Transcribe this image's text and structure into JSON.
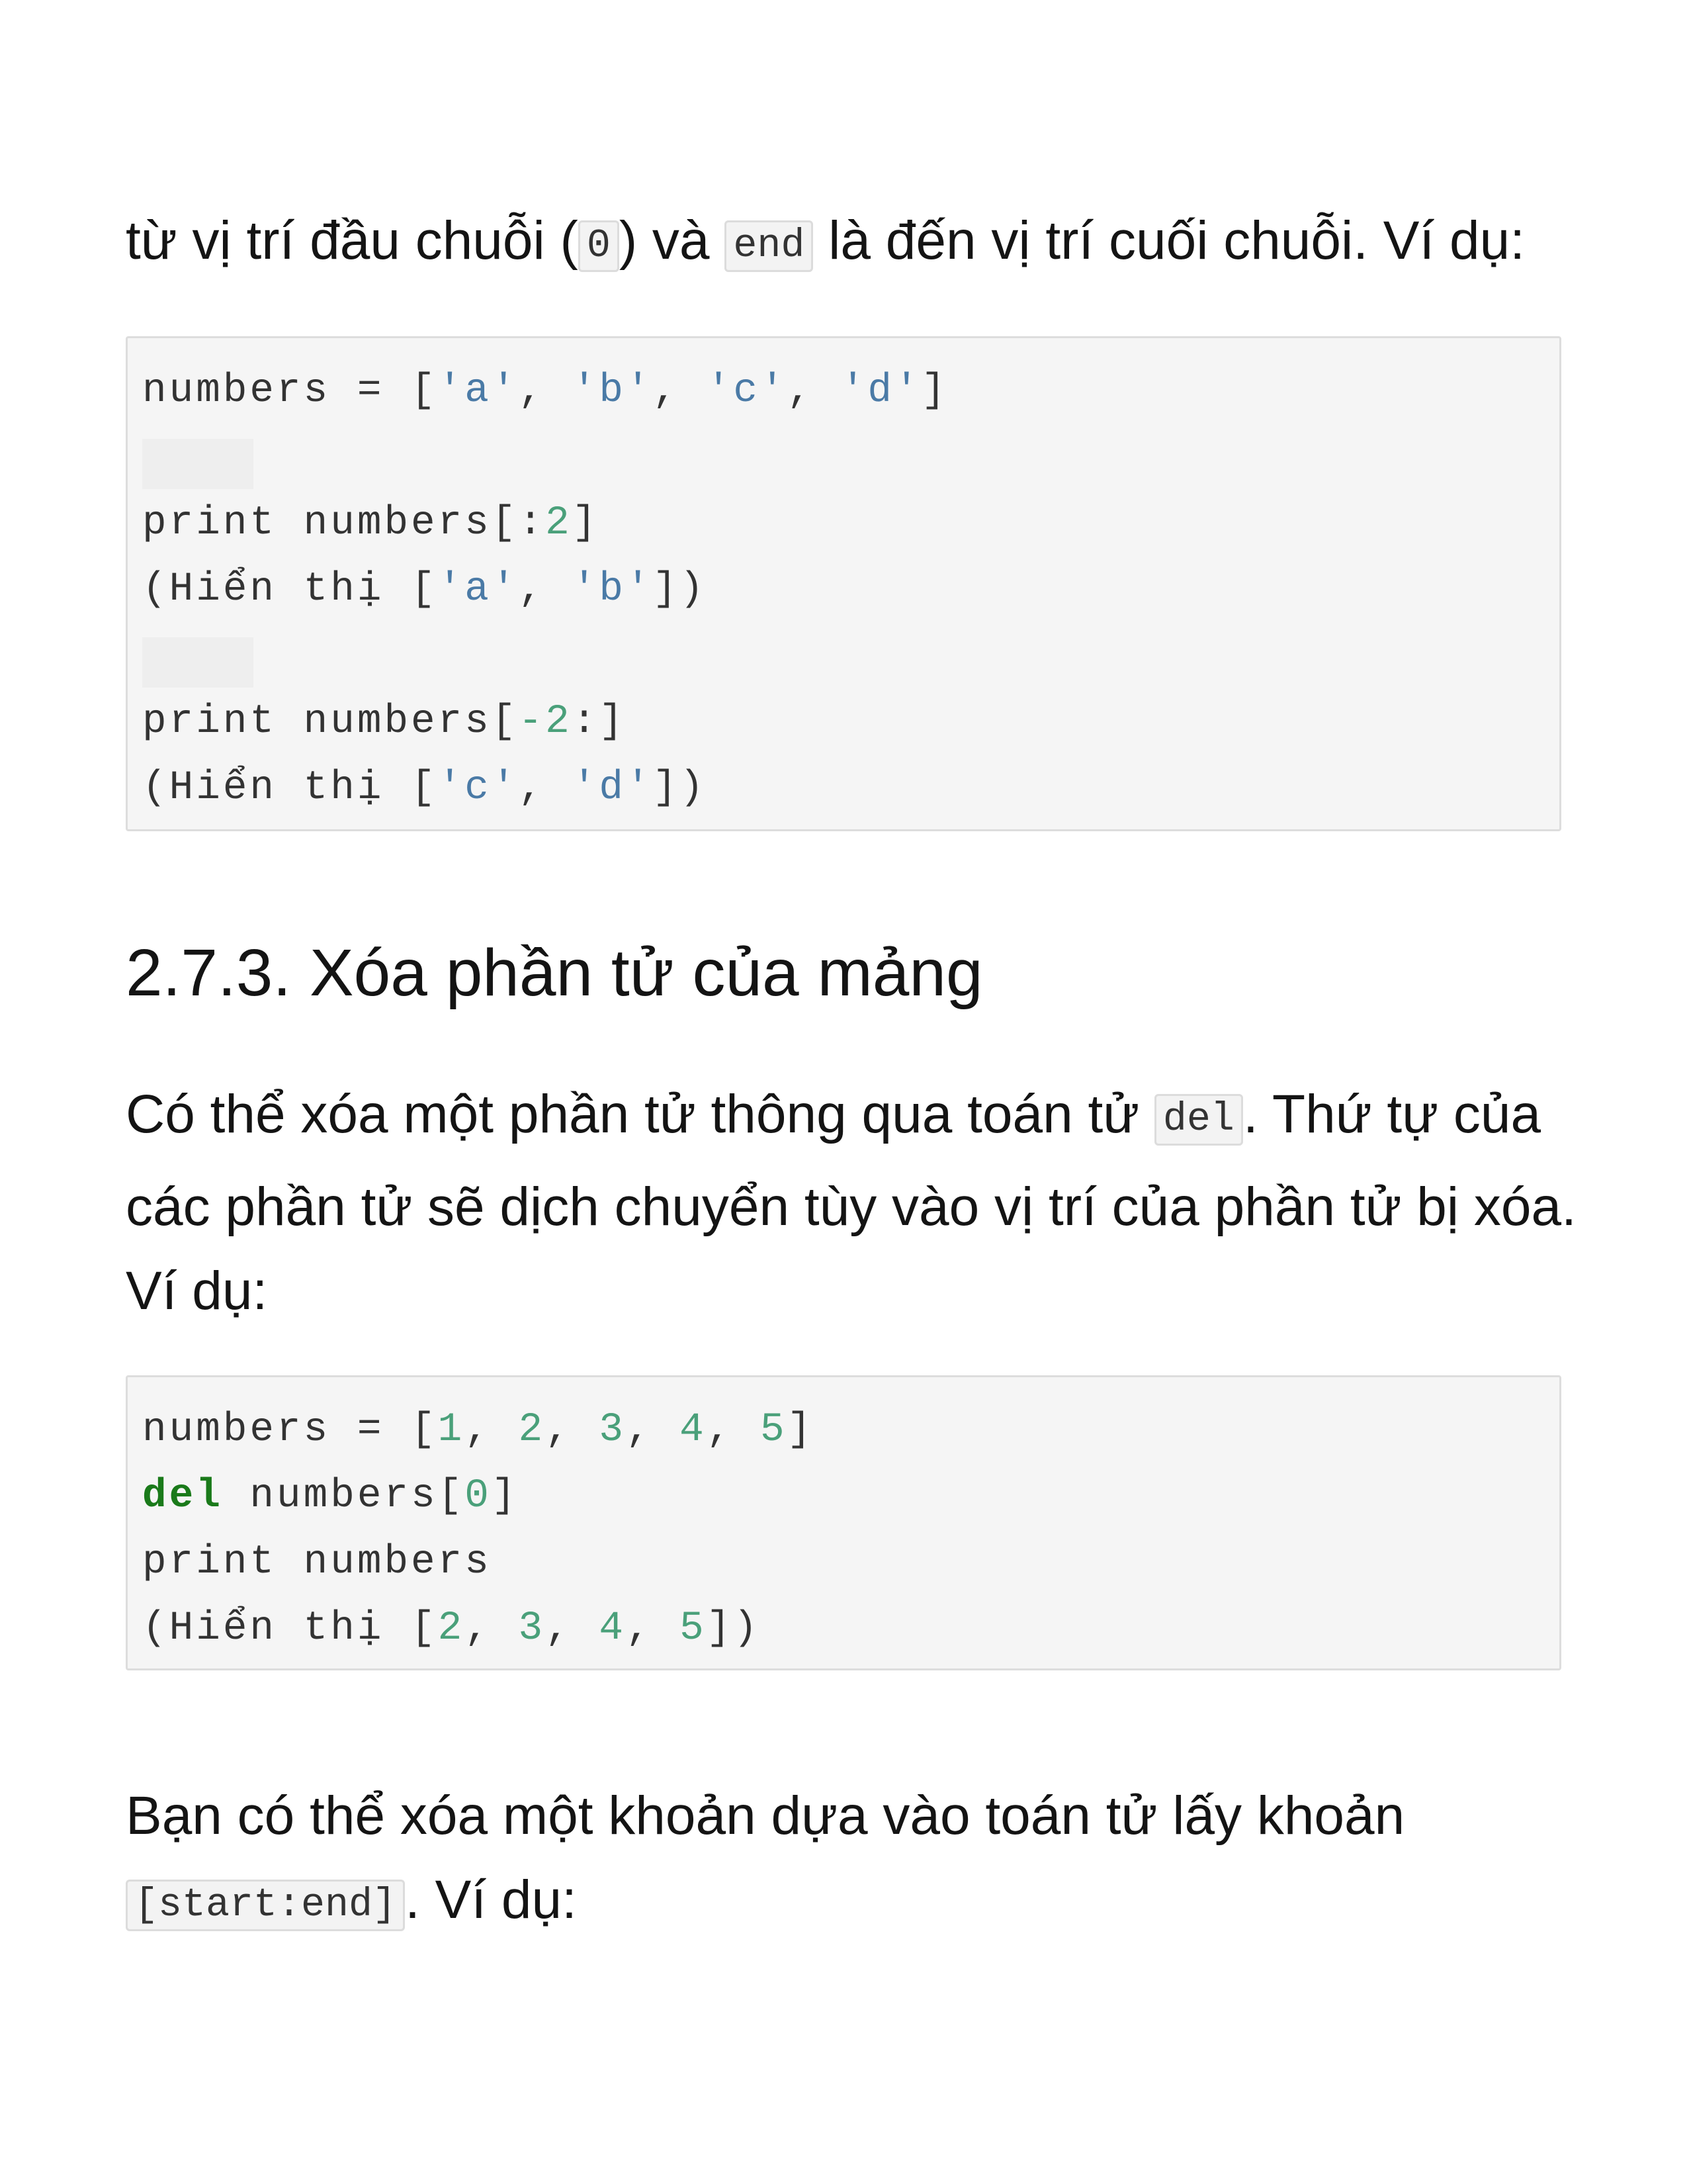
{
  "intro": {
    "text1": "từ vị trí đầu chuỗi (",
    "code1": "0",
    "text2": ") và ",
    "code2": "end",
    "text3": " là đến vị trí cuối chuỗi. Ví dụ:"
  },
  "code_block_1": {
    "line1": {
      "a": "numbers = [",
      "s1": "'a'",
      "c1": ", ",
      "s2": "'b'",
      "c2": ", ",
      "s3": "'c'",
      "c3": ", ",
      "s4": "'d'",
      "end": "]"
    },
    "line3": {
      "a": "print numbers[:",
      "n": "2",
      "end": "]"
    },
    "line4": {
      "a": "(Hiển thị [",
      "s1": "'a'",
      "c1": ", ",
      "s2": "'b'",
      "end": "])"
    },
    "line6": {
      "a": "print numbers[",
      "n": "-2",
      "end": ":]"
    },
    "line7": {
      "a": "(Hiển thị [",
      "s1": "'c'",
      "c1": ", ",
      "s2": "'d'",
      "end": "])"
    }
  },
  "heading": "2.7.3. Xóa phần tử của mảng",
  "del_para": {
    "text1": "Có thể xóa một phần tử thông qua toán tử ",
    "code": "del",
    "text2": ". Thứ tự của các phần tử sẽ dịch chuyển tùy vào vị trí của phần tử bị xóa. Ví dụ:"
  },
  "code_block_2": {
    "line1": {
      "a": "numbers = [",
      "n1": "1",
      "c1": ", ",
      "n2": "2",
      "c2": ", ",
      "n3": "3",
      "c3": ", ",
      "n4": "4",
      "c4": ", ",
      "n5": "5",
      "end": "]"
    },
    "line2": {
      "kw": "del",
      "a": " numbers[",
      "n": "0",
      "end": "]"
    },
    "line3": {
      "a": "print numbers"
    },
    "line4": {
      "a": "(Hiển thị [",
      "n1": "2",
      "c1": ", ",
      "n2": "3",
      "c2": ", ",
      "n3": "4",
      "c3": ", ",
      "n4": "5",
      "end": "])"
    }
  },
  "slice_para": {
    "text1": "Bạn có thể xóa một khoản dựa vào toán tử lấy khoản ",
    "code": "[start:end]",
    "text2": ". Ví dụ:"
  },
  "colors": {
    "string": "#4a7aa6",
    "number": "#4aa07a",
    "keyword": "#1a7a1a",
    "code_bg": "#f5f5f5"
  }
}
